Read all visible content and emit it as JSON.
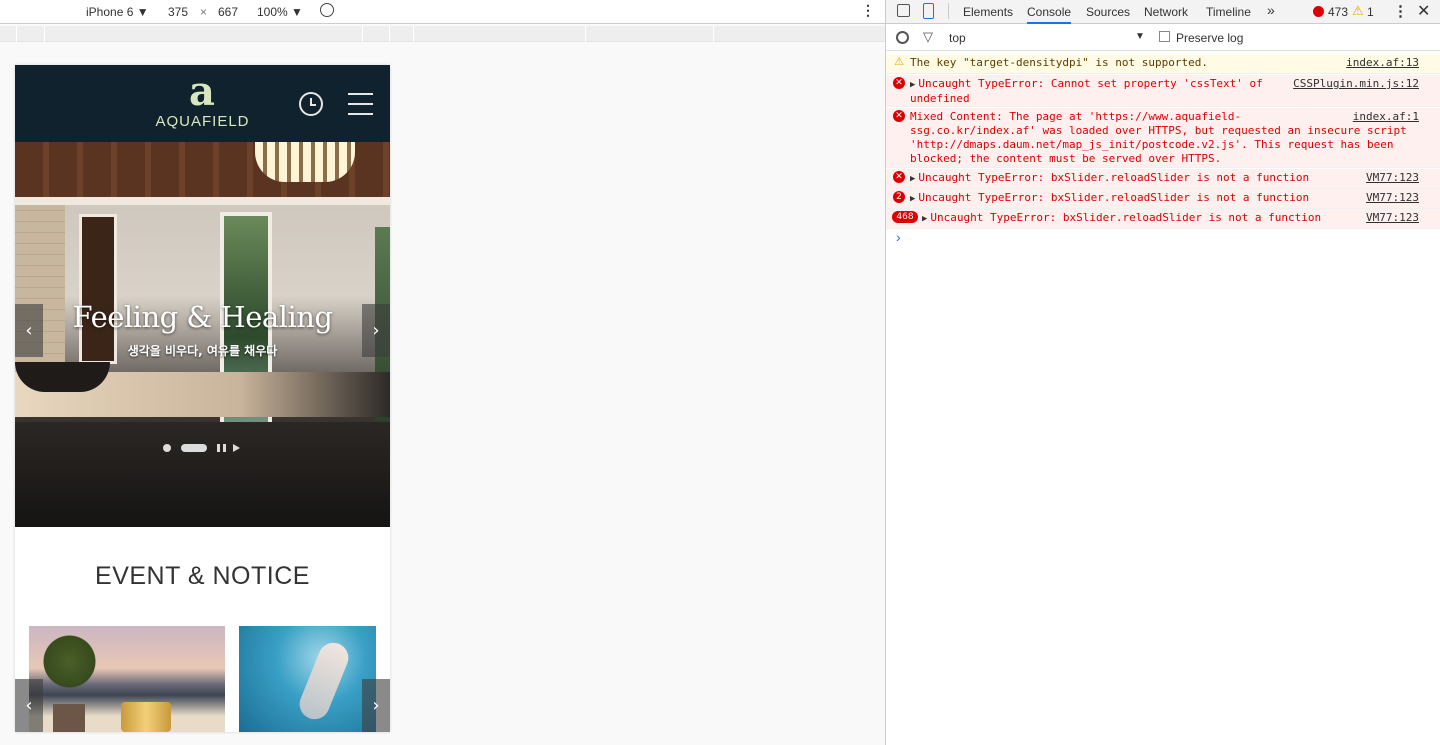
{
  "device_toolbar": {
    "device": "iPhone 6",
    "width": "375",
    "times": "×",
    "height": "667",
    "zoom": "100%"
  },
  "site": {
    "logo_mark": "a",
    "logo_text": "AQUAFIELD",
    "hero_title": "Feeling & Healing",
    "hero_subtitle": "생각을 비우다, 여유를 채우다",
    "prev_arrow": "‹",
    "next_arrow": "›",
    "section_title": "EVENT & NOTICE"
  },
  "devtools": {
    "tabs": [
      "Elements",
      "Console",
      "Sources",
      "Network",
      "Timeline"
    ],
    "more_tabs": "»",
    "error_count": "473",
    "warning_count": "1",
    "context": "top",
    "preserve_log": "Preserve log",
    "prompt": "›",
    "messages": [
      {
        "level": "warning",
        "text": "The key \"target-densitydpi\" is not supported.",
        "source": "index.af:13"
      },
      {
        "level": "error",
        "text": "Uncaught TypeError: Cannot set property 'cssText' of\nundefined",
        "source": "CSSPlugin.min.js:12"
      },
      {
        "level": "error",
        "text": "Mixed Content: The page at 'https://www.aquafield-\nssg.co.kr/index.af' was loaded over HTTPS, but requested an insecure script\n'http://dmaps.daum.net/map_js_init/postcode.v2.js'. This request has been\nblocked; the content must be served over HTTPS.",
        "source": "index.af:1"
      },
      {
        "level": "error",
        "text": "Uncaught TypeError: bxSlider.reloadSlider is not a function",
        "source": "VM77:123"
      },
      {
        "level": "error",
        "count": "2",
        "text": "Uncaught TypeError: bxSlider.reloadSlider is not a function",
        "source": "VM77:123"
      },
      {
        "level": "error",
        "count": "468",
        "text": "Uncaught TypeError: bxSlider.reloadSlider is not a function",
        "source": "VM77:123"
      }
    ]
  },
  "colors": {
    "header_bg": "#10222e",
    "logo_color": "#d8e7bf",
    "error_red": "#d00",
    "console_tab_accent": "#1a73e8"
  }
}
